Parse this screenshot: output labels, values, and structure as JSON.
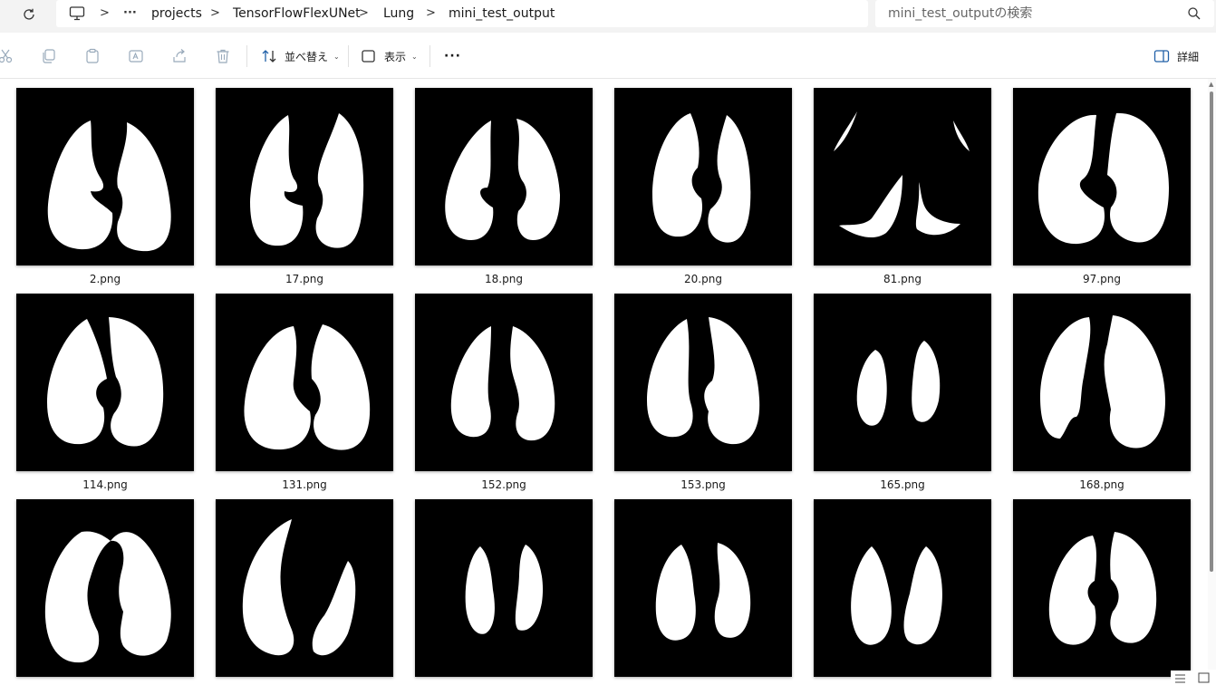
{
  "breadcrumb": {
    "items": [
      "projects",
      "TensorFlowFlexUNet",
      "Lung",
      "mini_test_output"
    ],
    "overflow": "···",
    "separator": ">"
  },
  "search": {
    "placeholder": "mini_test_outputの検索"
  },
  "toolbar": {
    "sort_label": "並べ替え",
    "view_label": "表示",
    "more_label": "···",
    "details_label": "詳細"
  },
  "icons": {
    "refresh": "refresh-icon",
    "pc": "computer-icon",
    "search": "search-icon",
    "cut": "cut-icon",
    "copy": "copy-icon",
    "paste": "paste-icon",
    "rename": "rename-icon",
    "share": "share-icon",
    "delete": "trash-icon",
    "sort": "sort-icon",
    "view": "view-icon",
    "details": "details-pane-icon"
  },
  "files": [
    {
      "name": "2.png"
    },
    {
      "name": "17.png"
    },
    {
      "name": "18.png"
    },
    {
      "name": "20.png"
    },
    {
      "name": "81.png"
    },
    {
      "name": "97.png"
    },
    {
      "name": "114.png"
    },
    {
      "name": "131.png"
    },
    {
      "name": "152.png"
    },
    {
      "name": "153.png"
    },
    {
      "name": "165.png"
    },
    {
      "name": "168.png"
    },
    {
      "name": ""
    },
    {
      "name": ""
    },
    {
      "name": ""
    },
    {
      "name": ""
    },
    {
      "name": ""
    },
    {
      "name": ""
    }
  ]
}
